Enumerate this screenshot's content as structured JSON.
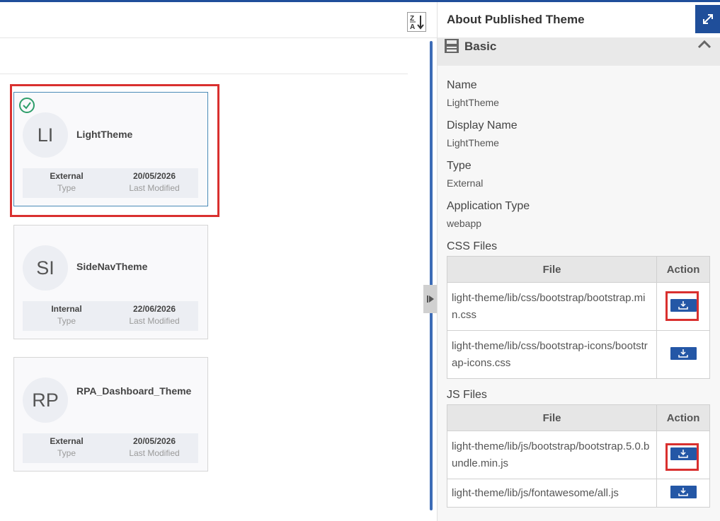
{
  "left": {
    "sort_icon": "sort-za-icon",
    "cards": [
      {
        "initials": "LI",
        "name": "LightTheme",
        "type_value": "External",
        "type_label": "Type",
        "date_value": "20/05/2026",
        "date_label": "Last Modified",
        "selected": true
      },
      {
        "initials": "SI",
        "name": "SideNavTheme",
        "type_value": "Internal",
        "type_label": "Type",
        "date_value": "22/06/2026",
        "date_label": "Last Modified",
        "selected": false
      },
      {
        "initials": "RP",
        "name": "RPA_Dashboard_Theme",
        "type_value": "External",
        "type_label": "Type",
        "date_value": "20/05/2026",
        "date_label": "Last Modified",
        "selected": false
      }
    ]
  },
  "right": {
    "title": "About Published Theme",
    "section": "Basic",
    "fields": {
      "name_label": "Name",
      "name_value": "LightTheme",
      "display_label": "Display Name",
      "display_value": "LightTheme",
      "type_label": "Type",
      "type_value": "External",
      "apptype_label": "Application Type",
      "apptype_value": "webapp"
    },
    "css": {
      "label": "CSS Files",
      "col_file": "File",
      "col_action": "Action",
      "rows": [
        {
          "file": "light-theme/lib/css/bootstrap/bootstrap.min.css"
        },
        {
          "file": "light-theme/lib/css/bootstrap-icons/bootstrap-icons.css"
        }
      ]
    },
    "js": {
      "label": "JS Files",
      "col_file": "File",
      "col_action": "Action",
      "rows": [
        {
          "file": "light-theme/lib/js/bootstrap/bootstrap.5.0.bundle.min.js"
        },
        {
          "file": "light-theme/lib/js/fontawesome/all.js"
        }
      ]
    }
  },
  "colors": {
    "accent": "#1f4e9a",
    "highlight": "#d9302f",
    "success": "#2e9e6a"
  }
}
